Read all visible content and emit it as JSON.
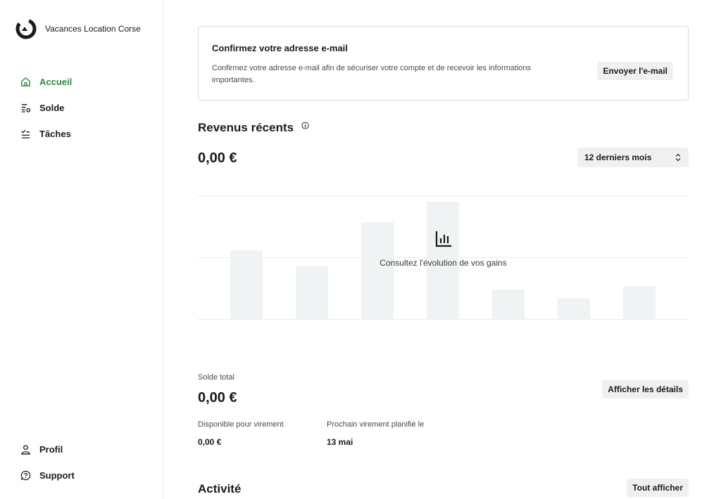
{
  "sidebar": {
    "brand_name": "Vacances Location Corse",
    "nav": [
      {
        "label": "Accueil",
        "icon": "home-icon",
        "active": true
      },
      {
        "label": "Solde",
        "icon": "balance-icon",
        "active": false
      },
      {
        "label": "Tâches",
        "icon": "tasks-icon",
        "active": false
      }
    ],
    "bottom_nav": [
      {
        "label": "Profil",
        "icon": "user-icon"
      },
      {
        "label": "Support",
        "icon": "help-icon"
      }
    ]
  },
  "banner": {
    "title": "Confirmez votre adresse e-mail",
    "text": "Confirmez votre adresse e-mail afin de sécuriser votre compte et de recevoir les informations importantes.",
    "button_label": "Envoyer l'e-mail"
  },
  "revenue": {
    "title": "Revenus récents",
    "amount": "0,00 €",
    "period_select": "12 derniers mois",
    "empty_caption": "Consultez l'évolution de vos gains"
  },
  "chart_data": {
    "type": "bar",
    "values": [
      100,
      77,
      141,
      171,
      43,
      30,
      48
    ],
    "ylim": [
      0,
      180
    ],
    "grid": true
  },
  "balance": {
    "label": "Solde total",
    "amount": "0,00 €",
    "details_button": "Afficher les détails",
    "available_label": "Disponible pour virement",
    "available_value": "0,00 €",
    "next_payout_label": "Prochain virement planifié le",
    "next_payout_value": "13 mai"
  },
  "activity": {
    "title": "Activité",
    "view_all_button": "Tout afficher"
  },
  "colors": {
    "accent": "#2e8b3e",
    "placeholder_bar": "#f0f3f3",
    "button_bg": "#eef0f1"
  }
}
